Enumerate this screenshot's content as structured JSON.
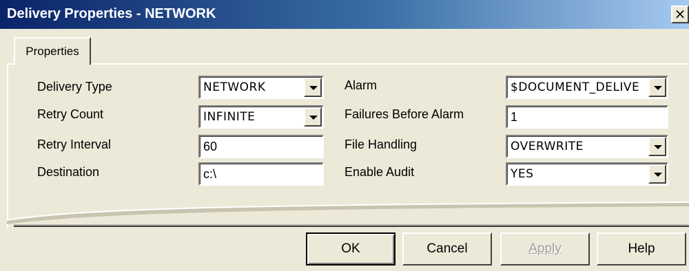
{
  "window": {
    "title": "Delivery Properties - NETWORK",
    "close_glyph": "×"
  },
  "tabs": [
    {
      "label": "Properties"
    }
  ],
  "left_fields": [
    {
      "label": "Delivery Type",
      "value": "NETWORK",
      "kind": "dropdown"
    },
    {
      "label": "Retry Count",
      "value": "INFINITE",
      "kind": "dropdown"
    },
    {
      "label": "Retry Interval",
      "value": "60",
      "kind": "text"
    },
    {
      "label": "Destination",
      "value": "c:\\",
      "kind": "text"
    }
  ],
  "right_fields": [
    {
      "label": "Alarm",
      "value": "$DOCUMENT_DELIVE",
      "kind": "dropdown"
    },
    {
      "label": "Failures Before Alarm",
      "value": "1",
      "kind": "text"
    },
    {
      "label": "File Handling",
      "value": "OVERWRITE",
      "kind": "dropdown"
    },
    {
      "label": "Enable Audit",
      "value": "YES",
      "kind": "dropdown"
    }
  ],
  "buttons": {
    "ok": "OK",
    "cancel": "Cancel",
    "apply": "Apply",
    "help": "Help"
  },
  "colors": {
    "title_start": "#0a246a",
    "title_end": "#a6caf0",
    "face": "#ece9d8"
  }
}
